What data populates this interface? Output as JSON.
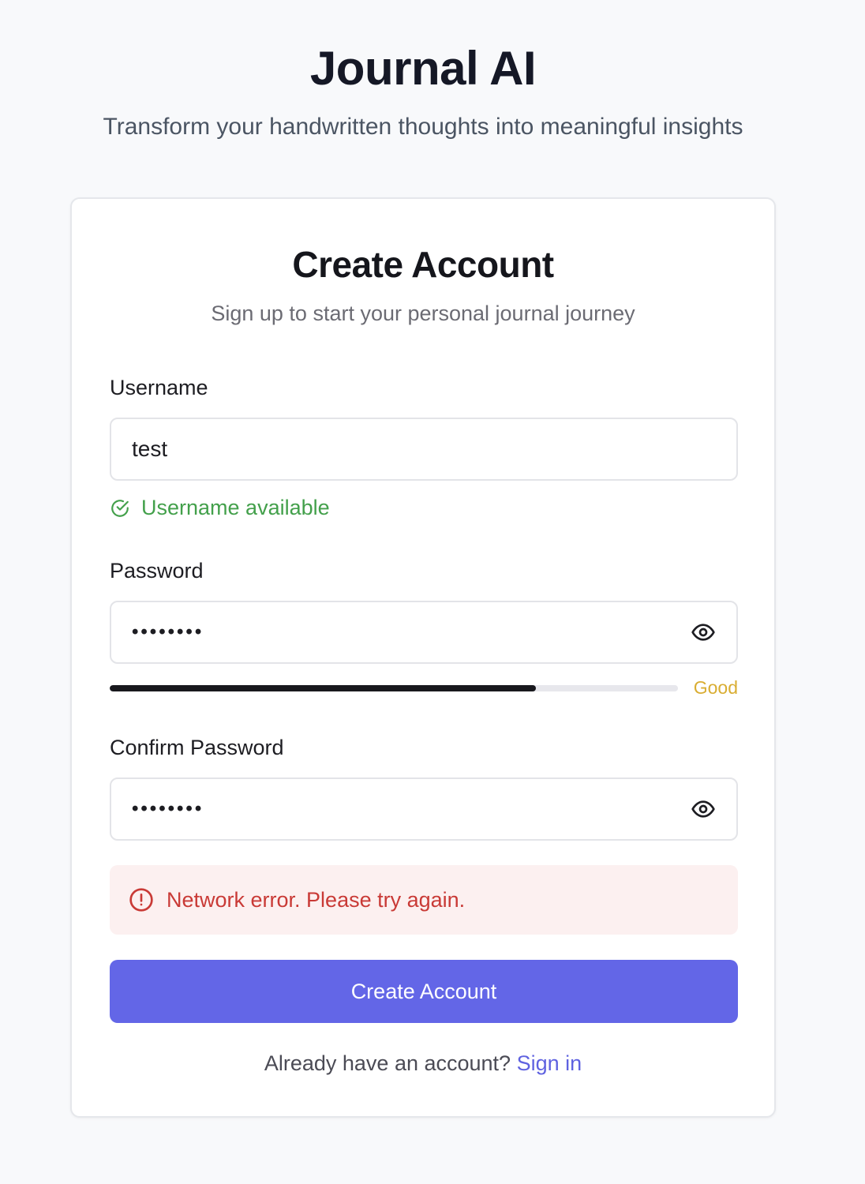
{
  "header": {
    "title": "Journal AI",
    "subtitle": "Transform your handwritten thoughts into meaningful insights"
  },
  "form": {
    "title": "Create Account",
    "subtitle": "Sign up to start your personal journal journey",
    "username": {
      "label": "Username",
      "value": "test",
      "status": "Username available"
    },
    "password": {
      "label": "Password",
      "masked_value": "••••••••",
      "strength_label": "Good",
      "strength_fraction": 0.75
    },
    "confirm_password": {
      "label": "Confirm Password",
      "masked_value": "••••••••"
    },
    "error_message": "Network error. Please try again.",
    "submit_label": "Create Account",
    "footer_prompt": "Already have an account?",
    "footer_link": "Sign in"
  },
  "icons": {
    "status_ok": "check-circle-icon",
    "toggle_visibility": "eye-icon",
    "error": "alert-circle-icon"
  },
  "colors": {
    "accent": "#6366e7",
    "success": "#43a04b",
    "warning": "#d9ad32",
    "error": "#c93a36",
    "error_bg": "#fcf0f0"
  }
}
